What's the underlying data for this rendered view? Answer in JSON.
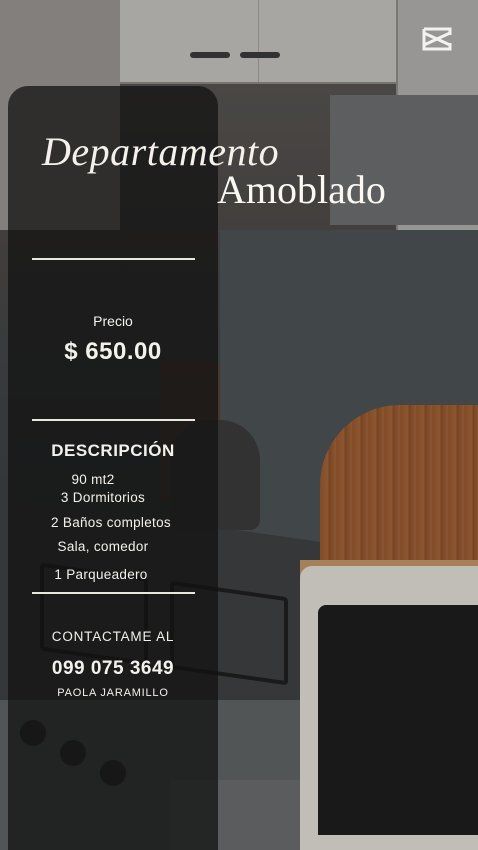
{
  "title": {
    "line1": "Departamento",
    "line2": "Amoblado"
  },
  "price": {
    "label": "Precio",
    "value": "$ 650.00"
  },
  "description": {
    "heading": "DESCRIPCIÓN",
    "items": [
      "90 mt2",
      "3 Dormitorios",
      "2 Baños completos",
      "Sala, comedor",
      "1 Parqueadero"
    ]
  },
  "contact": {
    "heading": "CONTACTAME AL",
    "phone": "099 075 3649",
    "name": "PAOLA JARAMILLO"
  },
  "icons": {
    "app_logo": "capcut-logo-icon"
  },
  "colors": {
    "text": "#f3f1ec",
    "panel": "rgba(18,18,18,0.74)"
  }
}
